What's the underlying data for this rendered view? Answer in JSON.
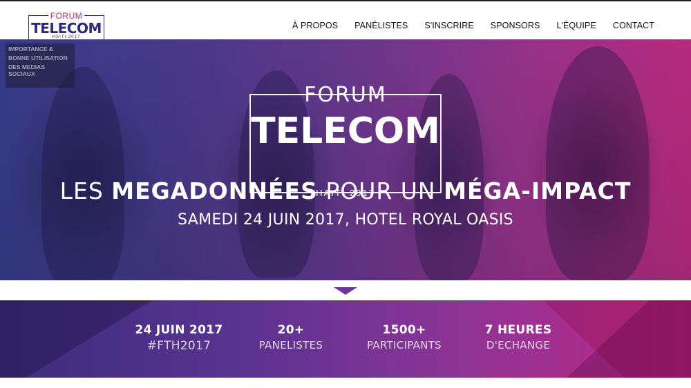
{
  "header": {
    "logo": {
      "forum": "FORUM",
      "telecom": "TELECOM",
      "haiti": "HAITI 2017"
    },
    "nav": [
      "À PROPOS",
      "PANÉLISTES",
      "S'INSCRIRE",
      "SPONSORS",
      "L'ÉQUIPE",
      "CONTACT"
    ]
  },
  "hero": {
    "sign_text": [
      "IMPORTANCE &",
      "BONNE UTILISATION",
      "DES MEDIAS SOCIAUX"
    ],
    "logo": {
      "forum": "FORUM",
      "telecom": "TELECOM",
      "haiti": "HAITI 2017"
    },
    "title": {
      "part1": "LES ",
      "part2": "MEGADONNÉES",
      "part3": " POUR UN ",
      "part4": "MÉGA-IMPACT"
    },
    "subtitle": "SAMEDI 24 JUIN 2017, HOTEL ROYAL OASIS"
  },
  "stats": [
    {
      "big": "24 JUIN 2017",
      "small": "#FTH2017"
    },
    {
      "big": "20+",
      "small": "PANELISTES"
    },
    {
      "big": "1500+",
      "small": "PARTICIPANTS"
    },
    {
      "big": "7 HEURES",
      "small": "D'ECHANGE"
    }
  ],
  "colors": {
    "brand_navy": "#2e2a78",
    "brand_magenta": "#c0266d",
    "arrow": "#6a3794"
  }
}
